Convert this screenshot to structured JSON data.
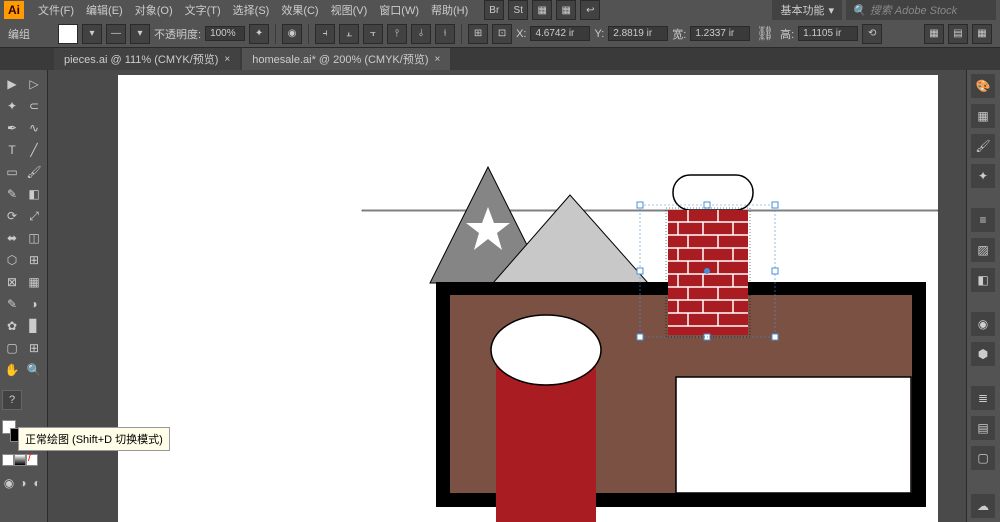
{
  "menubar": {
    "logo": "Ai",
    "items": [
      "文件(F)",
      "编辑(E)",
      "对象(O)",
      "文字(T)",
      "选择(S)",
      "效果(C)",
      "视图(V)",
      "窗口(W)",
      "帮助(H)"
    ],
    "workspace": "基本功能",
    "search_placeholder": "搜索 Adobe Stock"
  },
  "controlbar": {
    "mode": "编组",
    "opacity_label": "不透明度:",
    "opacity_value": "100%",
    "x_label": "X:",
    "x_value": "4.6742 ir",
    "y_label": "Y:",
    "y_value": "2.8819 ir",
    "w_label": "宽:",
    "w_value": "1.2337 ir",
    "h_label": "高:",
    "h_value": "1.1105 ir"
  },
  "tabs": {
    "tab1": "pieces.ai @ 111% (CMYK/预览)",
    "tab2": "homesale.ai* @ 200% (CMYK/预览)"
  },
  "tooltip_text": "正常绘图 (Shift+D 切换模式)",
  "help_mark": "?"
}
